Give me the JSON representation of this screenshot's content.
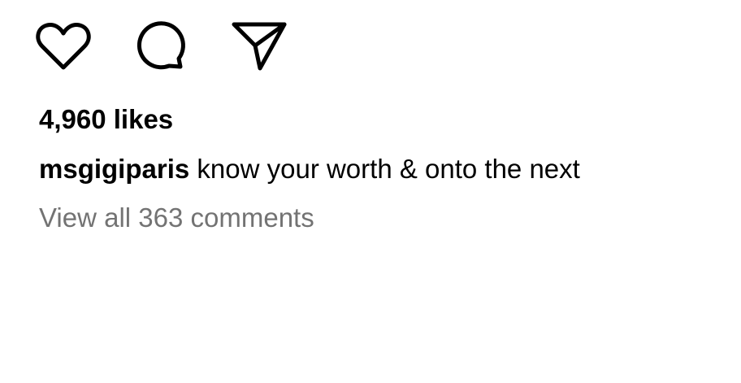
{
  "actions": {
    "like_icon": "heart-icon",
    "comment_icon": "comment-icon",
    "share_icon": "paper-plane-icon"
  },
  "post": {
    "likes": "4,960 likes",
    "caption_user": "msgigiparis",
    "caption_text": "know your worth & onto the next",
    "view_all_comments": "View all 363 comments"
  }
}
